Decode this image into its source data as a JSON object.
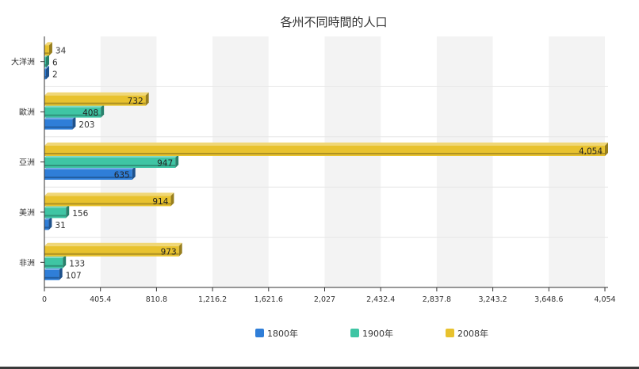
{
  "chart_data": {
    "type": "bar",
    "orientation": "horizontal",
    "title": "各州不同時間的人口",
    "categories": [
      "非洲",
      "美洲",
      "亞洲",
      "歐洲",
      "大洋洲"
    ],
    "series": [
      {
        "name": "1800年",
        "values": [
          107,
          31,
          635,
          203,
          2
        ],
        "color": "#2f7ed8"
      },
      {
        "name": "1900年",
        "values": [
          133,
          156,
          947,
          408,
          6
        ],
        "color": "#3fc5a4"
      },
      {
        "name": "2008年",
        "values": [
          973,
          914,
          4054,
          732,
          34
        ],
        "color": "#e8c22e"
      }
    ],
    "xlim": [
      0,
      4054
    ],
    "xticks": [
      "0",
      "405.4",
      "810.8",
      "1,216.2",
      "1,621.6",
      "2,027",
      "2,432.4",
      "2,837.8",
      "3,243.2",
      "3,648.6",
      "4,054"
    ],
    "value_labels": {
      "1800年": [
        "107",
        "31",
        "635",
        "203",
        "2"
      ],
      "1900年": [
        "133",
        "156",
        "947",
        "408",
        "6"
      ],
      "2008年": [
        "973",
        "914",
        "4,054",
        "732",
        "34"
      ]
    },
    "grid": "alternating vertical bands",
    "legend_position": "bottom"
  }
}
